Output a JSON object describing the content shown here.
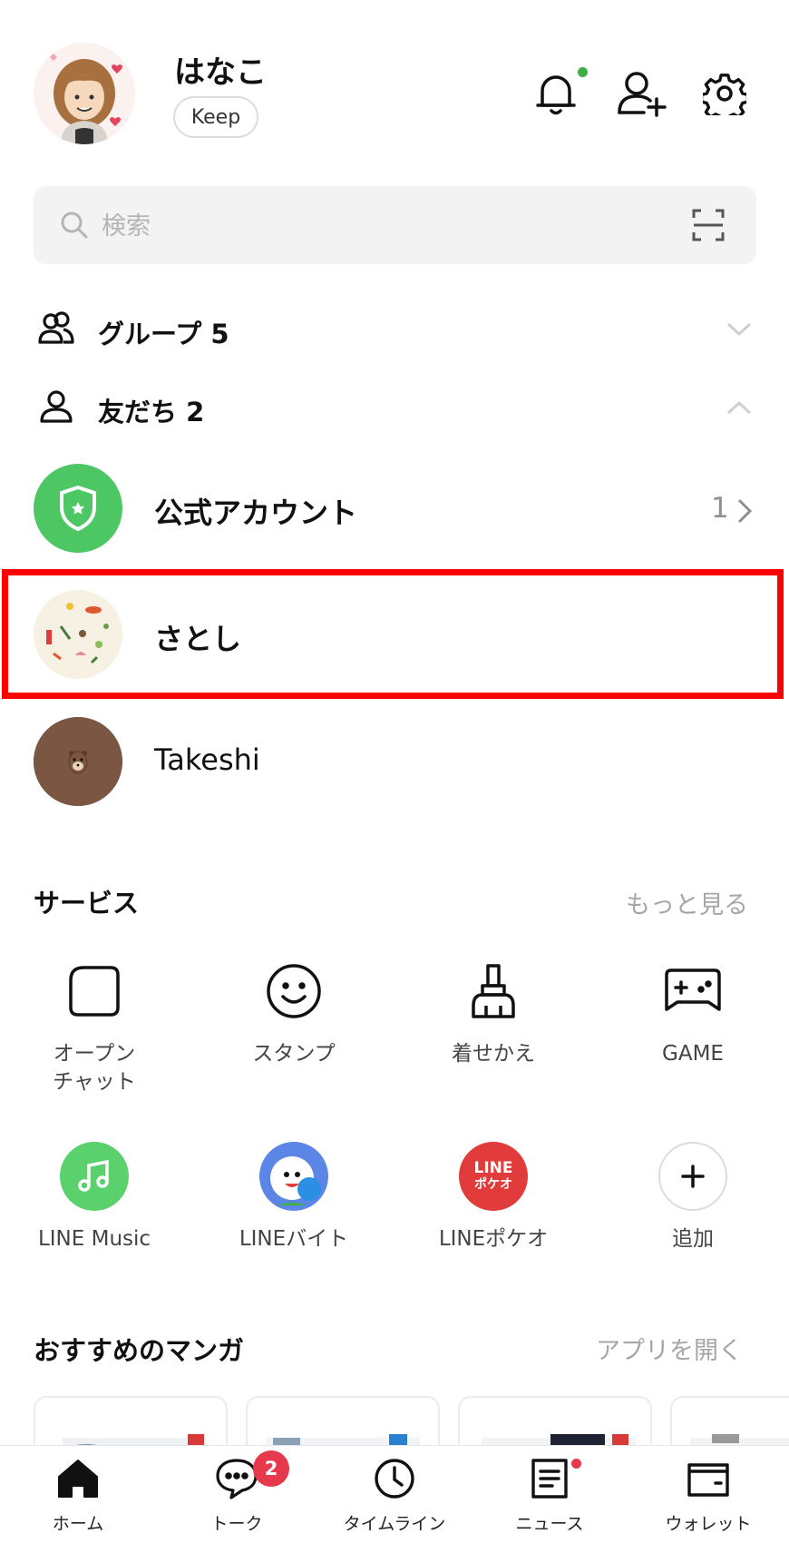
{
  "profile": {
    "name": "はなこ",
    "keep_label": "Keep"
  },
  "search": {
    "placeholder": "検索"
  },
  "sections": {
    "groups_label": "グループ 5",
    "friends_label": "友だち 2"
  },
  "friends": [
    {
      "name": "公式アカウント",
      "count": "1"
    },
    {
      "name": "さとし"
    },
    {
      "name": "Takeshi"
    }
  ],
  "services": {
    "title": "サービス",
    "more_label": "もっと見る",
    "items": [
      {
        "label": "オープン\nチャット",
        "icon": "open-chat-icon"
      },
      {
        "label": "スタンプ",
        "icon": "smile-icon"
      },
      {
        "label": "着せかえ",
        "icon": "brush-icon"
      },
      {
        "label": "GAME",
        "icon": "gamepad-icon"
      },
      {
        "label": "LINE Music",
        "icon": "music-note-icon",
        "color": "#5ad16d"
      },
      {
        "label": "LINEバイト",
        "icon": "line-baito-icon",
        "color": "#5b86e5"
      },
      {
        "label": "LINEポケオ",
        "icon": "line-pokeo-icon",
        "color": "#e23b3b",
        "logo_text": [
          "LINE",
          "ポケオ"
        ]
      },
      {
        "label": "追加",
        "icon": "plus-icon"
      }
    ]
  },
  "manga": {
    "title": "おすすめのマンガ",
    "open_app_label": "アプリを開く"
  },
  "nav": {
    "items": [
      {
        "label": "ホーム",
        "icon": "home-icon"
      },
      {
        "label": "トーク",
        "icon": "chat-icon",
        "badge": "2"
      },
      {
        "label": "タイムライン",
        "icon": "clock-icon"
      },
      {
        "label": "ニュース",
        "icon": "news-icon"
      },
      {
        "label": "ウォレット",
        "icon": "wallet-icon"
      }
    ]
  },
  "colors": {
    "accent_green": "#4cc764",
    "badge_red": "#e6394b",
    "highlight_red": "#ff0000",
    "online_dot": "#3cb043"
  }
}
